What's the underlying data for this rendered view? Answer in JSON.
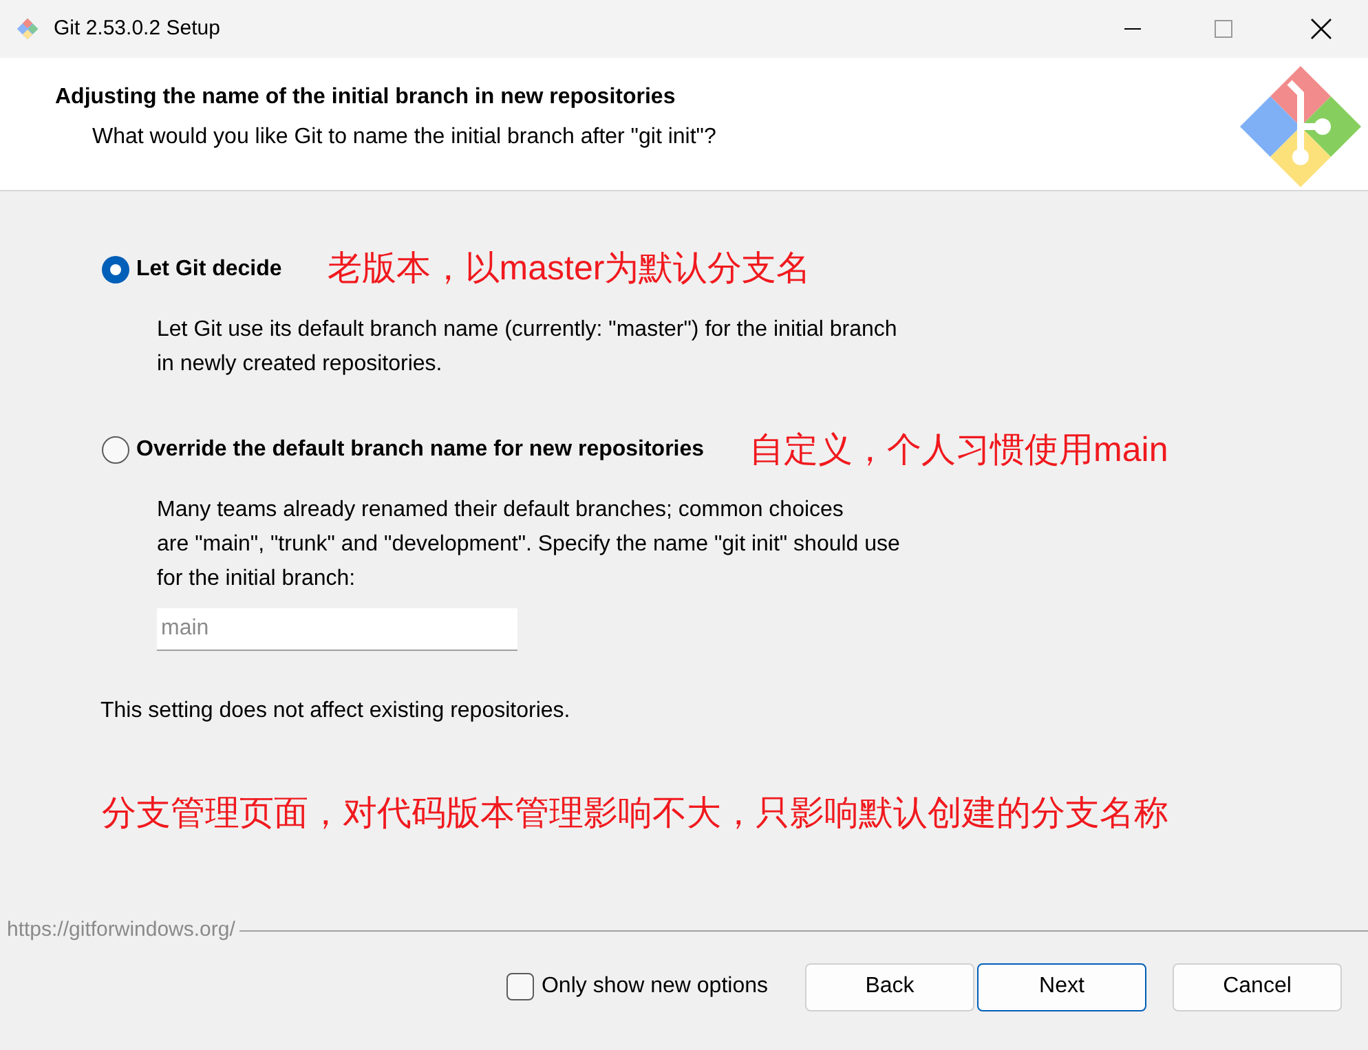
{
  "window": {
    "title": "Git 2.53.0.2 Setup"
  },
  "header": {
    "title": "Adjusting the name of the initial branch in new repositories",
    "subtitle": "What would you like Git to name the initial branch after \"git init\"?"
  },
  "options": [
    {
      "label": "Let Git decide",
      "selected": true,
      "description": [
        "Let Git use its default branch name (currently: \"master\") for the initial branch",
        "in newly created repositories."
      ],
      "note": "老版本，以master为默认分支名"
    },
    {
      "label": "Override the default branch name for new repositories",
      "selected": false,
      "description": [
        "Many teams already renamed their default branches; common choices",
        "are \"main\", \"trunk\" and \"development\". Specify the name \"git init\" should use",
        "for the initial branch:"
      ],
      "note": "自定义，个人习惯使用main",
      "field": {
        "placeholder": "main"
      }
    }
  ],
  "info": "This setting does not affect existing repositories.",
  "note": "分支管理页面，对代码版本管理影响不大，只影响默认创建的分支名称",
  "footer": {
    "url": "https://gitforwindows.org/",
    "checkbox": {
      "label": "Only show new options",
      "checked": false
    },
    "buttons": [
      {
        "label": "Back",
        "default": false
      },
      {
        "label": "Next",
        "default": true
      },
      {
        "label": "Cancel",
        "default": false
      }
    ]
  }
}
